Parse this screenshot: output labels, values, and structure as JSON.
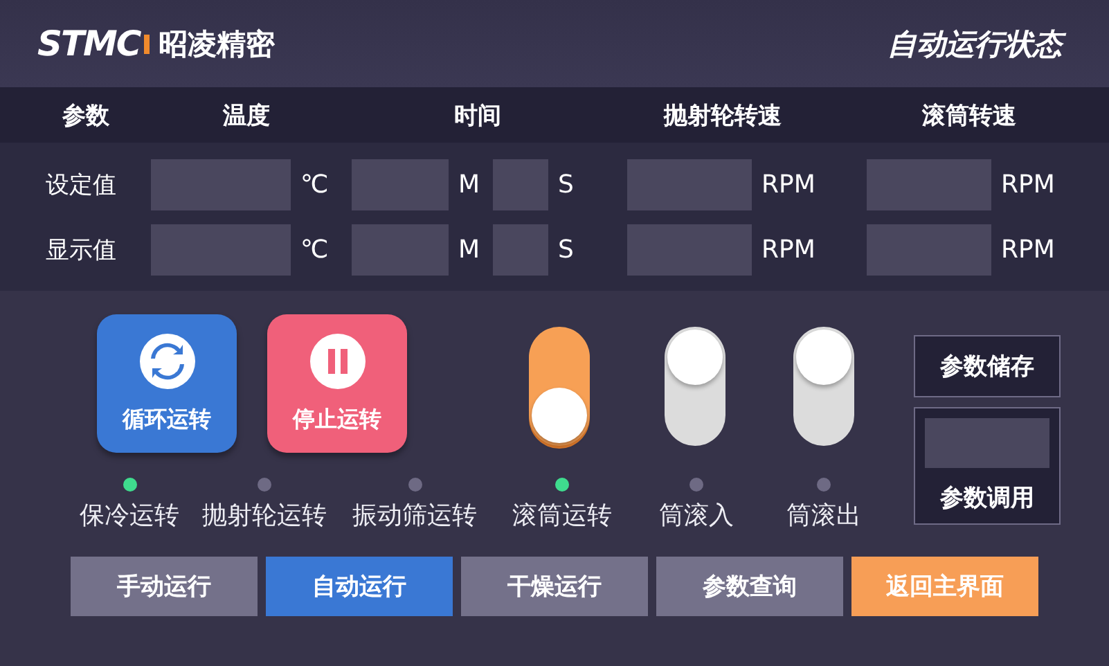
{
  "header": {
    "logo_mark": "STMC",
    "brand": "昭凌精密",
    "title": "自动运行状态"
  },
  "table": {
    "columns": [
      "参数",
      "温度",
      "时间",
      "抛射轮转速",
      "滚筒转速"
    ],
    "rows": [
      {
        "label": "设定值",
        "units": [
          "℃",
          "M",
          "S",
          "RPM",
          "RPM"
        ]
      },
      {
        "label": "显示值",
        "units": [
          "℃",
          "M",
          "S",
          "RPM",
          "RPM"
        ]
      }
    ]
  },
  "controls": [
    {
      "kind": "start",
      "label": "循环运转"
    },
    {
      "kind": "stop",
      "label": "停止运转"
    },
    {
      "kind": "switch",
      "on": true
    },
    {
      "kind": "switch",
      "on": false
    },
    {
      "kind": "switch",
      "on": false
    }
  ],
  "indicators": [
    {
      "label": "保冷运转",
      "on": true
    },
    {
      "label": "抛射轮运转",
      "on": false
    },
    {
      "label": "振动筛运转",
      "on": false
    },
    {
      "label": "滚筒运转",
      "on": true
    },
    {
      "label": "筒滚入",
      "on": false
    },
    {
      "label": "筒滚出",
      "on": false
    }
  ],
  "side": {
    "save_button": "参数储存",
    "recall_label": "参数调用"
  },
  "nav": [
    {
      "label": "手动运行",
      "kind": "tab",
      "selected": false
    },
    {
      "label": "自动运行",
      "kind": "tab",
      "selected": true
    },
    {
      "label": "干燥运行",
      "kind": "tab",
      "selected": false
    },
    {
      "label": "参数查询",
      "kind": "tab",
      "selected": false
    },
    {
      "label": "返回主界面",
      "kind": "exit",
      "selected": false
    }
  ]
}
